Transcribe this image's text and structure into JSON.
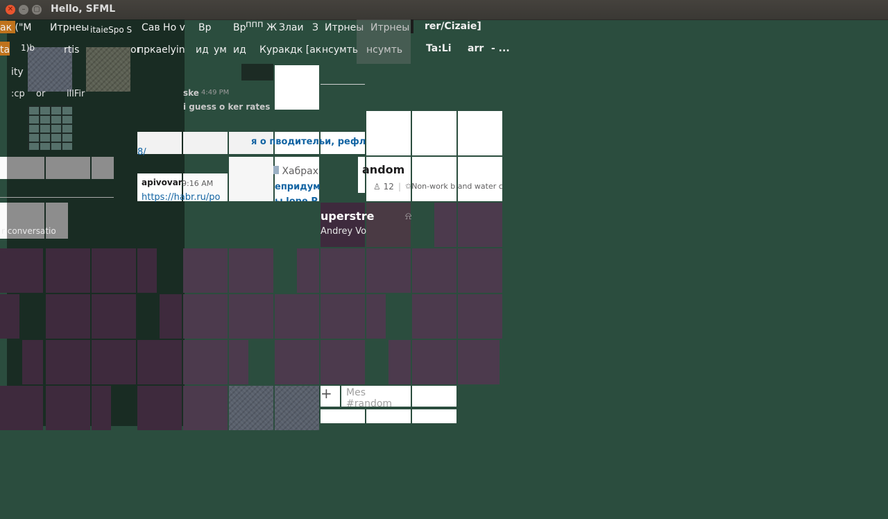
{
  "window": {
    "title": "Hello, SFML"
  },
  "top_menu": {
    "row1": [
      "ак (\"M",
      "Итрнеы",
      "itaieSpo S",
      "Сав Но v",
      "Вр",
      "Вр",
      "ппп",
      "Ж",
      "Злаи",
      "З",
      "Итрнеы",
      "Итрнеы",
      "rer/Cizaie]"
    ],
    "row2": [
      "ta",
      "1)b",
      "rtis",
      "or",
      "пркаelyin",
      "ид",
      "ум",
      "ид",
      "Куракдк [ак",
      "нсумть",
      "нсумть",
      "Ta:Li",
      "arr",
      "- ..."
    ]
  },
  "sidebar": {
    "row_ity": "ity",
    "row_cpu": ":cp",
    "row_or": "or",
    "row_killfir": "illFir",
    "footer": "r conversatio"
  },
  "messages": {
    "author1": "ske",
    "time1": "4:49 PM",
    "text1": "i guess o ker rates",
    "link_a": "8/",
    "author2": "apivovar",
    "time2": "9:16 AM",
    "link_b": "https://habr.ru/po",
    "preview_title": "я о пводительи, рефлек",
    "site_name": "Хабрах",
    "preview_sub1": "епридум",
    "preview_sub2": "ы lope P"
  },
  "channel": {
    "name": "andom",
    "members": "12",
    "topic": "Non-work b and water c",
    "dm_title": "uperstre",
    "dm_person": "Andrey Vo"
  },
  "composer": {
    "add_symbol": "+",
    "placeholder": "Mes #random"
  },
  "colors": {
    "background": "#2b4d3e",
    "slack_purple": "#4c3a4d",
    "link_blue": "#1264a3"
  }
}
